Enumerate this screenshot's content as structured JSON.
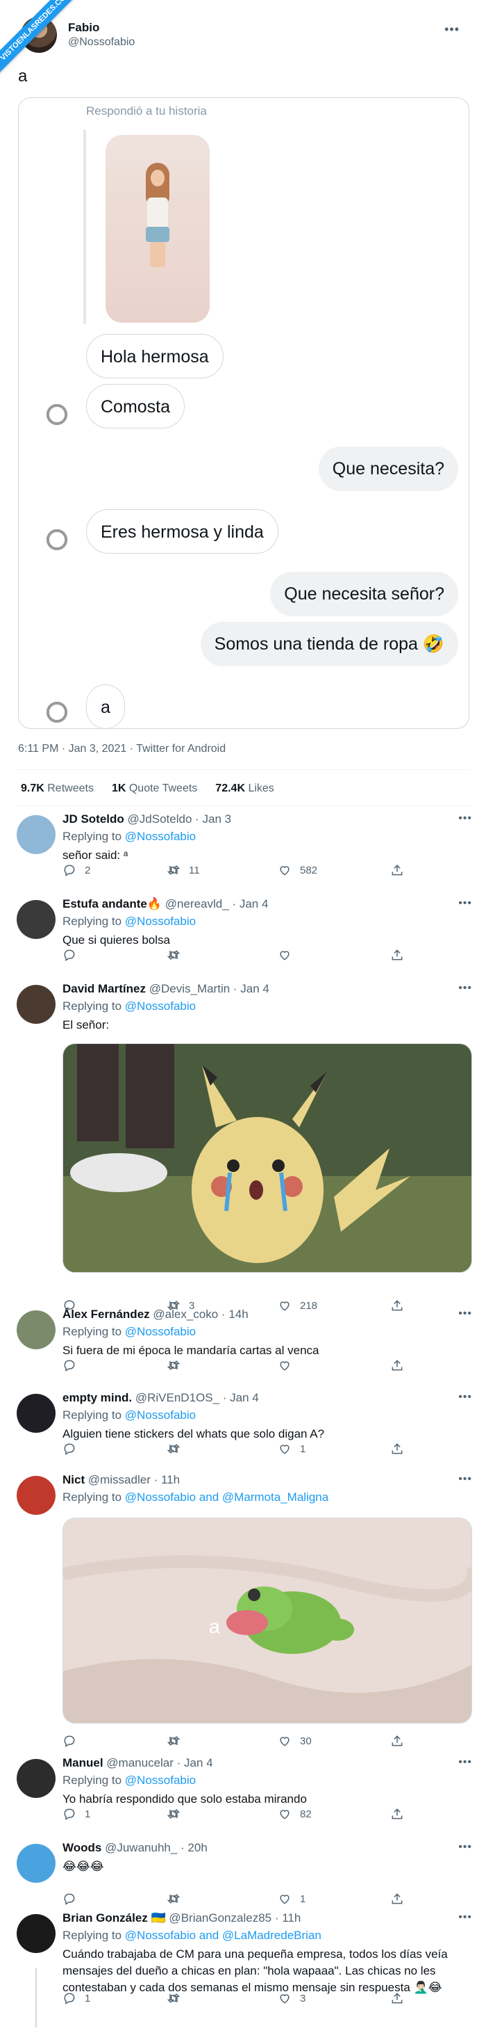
{
  "watermark": "VISTOENLASREDES.COM",
  "tweet": {
    "author_name": "Fabio",
    "author_handle": "@Nossofabio",
    "text": "a",
    "timestamp": "6:11 PM · Jan 3, 2021 · Twitter for Android",
    "stats": {
      "retweets_count": "9.7K",
      "retweets_label": "Retweets",
      "quotes_count": "1K",
      "quotes_label": "Quote Tweets",
      "likes_count": "72.4K",
      "likes_label": "Likes"
    }
  },
  "dm": {
    "replied_label": "Respondió a tu historia",
    "messages": [
      {
        "dir": "in",
        "text": "Hola hermosa"
      },
      {
        "dir": "in",
        "text": "Comosta"
      },
      {
        "dir": "out",
        "text": "Que necesita?"
      },
      {
        "dir": "in",
        "text": "Eres hermosa y linda"
      },
      {
        "dir": "out",
        "text": "Que necesita señor?"
      },
      {
        "dir": "out",
        "text": "Somos una tienda de ropa 🤣"
      },
      {
        "dir": "in",
        "text": "a"
      }
    ]
  },
  "replies": [
    {
      "name": "JD Soteldo",
      "handle": "@JdSoteldo",
      "time": "Jan 3",
      "replying_prefix": "Replying to ",
      "mention": "@Nossofabio",
      "text": "señor said: ᵃ",
      "replies": "2",
      "retweets": "11",
      "likes": "582",
      "avatar_color": "#8fb7d6"
    },
    {
      "name": "Estufa andante🔥",
      "handle": "@nereavld_",
      "time": "Jan 4",
      "replying_prefix": "Replying to ",
      "mention": "@Nossofabio",
      "text": "Que si quieres bolsa",
      "replies": "",
      "retweets": "",
      "likes": "",
      "avatar_color": "#3a3a3a"
    },
    {
      "name": "David Martínez",
      "handle": "@Devis_Martin",
      "time": "Jan 4",
      "replying_prefix": "Replying to ",
      "mention": "@Nossofabio",
      "text": "El señor:",
      "replies": "",
      "retweets": "3",
      "likes": "218",
      "avatar_color": "#4a3a30"
    },
    {
      "name": "Álex Fernández",
      "handle": "@alex_coko",
      "time": "14h",
      "replying_prefix": "Replying to ",
      "mention": "@Nossofabio",
      "text": "Si fuera de mi época le mandaría cartas al venca",
      "replies": "",
      "retweets": "",
      "likes": "",
      "avatar_color": "#7a8a6a"
    },
    {
      "name": "empty mind.",
      "handle": "@RiVEnD1OS_",
      "time": "Jan 4",
      "replying_prefix": "Replying to ",
      "mention": "@Nossofabio",
      "text": "Alguien tiene stickers del whats que solo digan A?",
      "replies": "",
      "retweets": "",
      "likes": "1",
      "avatar_color": "#1e1e24"
    },
    {
      "name": "Nict",
      "handle": "@missadler",
      "time": "11h",
      "replying_prefix": "Replying to ",
      "mention": "@Nossofabio and @Marmota_Maligna",
      "text": "",
      "replies": "",
      "retweets": "",
      "likes": "30",
      "avatar_color": "#c0392b"
    },
    {
      "name": "Manuel",
      "handle": "@manucelar",
      "time": "Jan 4",
      "replying_prefix": "Replying to ",
      "mention": "@Nossofabio",
      "text": "Yo habría respondido que solo estaba mirando",
      "replies": "1",
      "retweets": "",
      "likes": "82",
      "avatar_color": "#2c2c2c"
    },
    {
      "name": "Woods",
      "handle": "@Juwanuhh_",
      "time": "20h",
      "replying_prefix": "",
      "mention": "",
      "text": "😂😂😂",
      "replies": "",
      "retweets": "",
      "likes": "1",
      "avatar_color": "#4aa3df"
    },
    {
      "name": "Brian González",
      "handle": "🇺🇦 @BrianGonzalez85",
      "time": "11h",
      "replying_prefix": "Replying to ",
      "mention": "@Nossofabio and @LaMadredeBrian",
      "text": "Cuándo trabajaba de CM para una pequeña empresa, todos los días veía mensajes del dueño a chicas en plan:  \"hola wapaaa\". Las chicas no les contestaban y cada dos semanas el mismo mensaje sin respuesta 🤦🏻‍♂️😂",
      "replies": "1",
      "retweets": "",
      "likes": "3",
      "avatar_color": "#1a1a1a"
    }
  ],
  "media_caption_nict": "a",
  "colors": {
    "link": "#1d9bf0",
    "muted": "#536471",
    "border": "#cfd9de"
  }
}
